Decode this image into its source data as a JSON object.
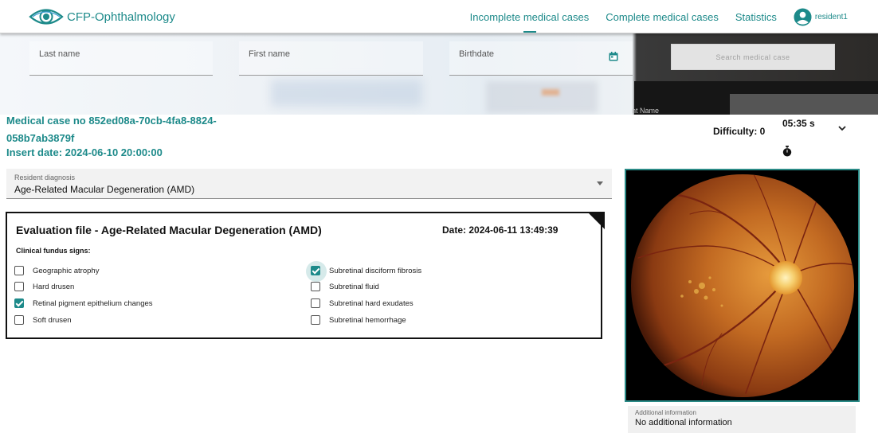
{
  "app": {
    "name": "CFP-Ophthalmology",
    "accent_color": "#1d8a8a"
  },
  "nav": {
    "items": [
      {
        "label": "Incomplete medical cases",
        "active": true
      },
      {
        "label": "Complete medical cases",
        "active": false
      },
      {
        "label": "Statistics",
        "active": false
      }
    ],
    "user": {
      "name": "resident1",
      "icon": "account-circle-icon"
    }
  },
  "search": {
    "last_name_placeholder": "Last name",
    "first_name_placeholder": "First name",
    "birthdate_placeholder": "Birthdate",
    "button_label": "Search medical case",
    "background_text": "nt Name"
  },
  "case": {
    "title": "Medical case no 852ed08a-70cb-4fa8-8824-058b7ab3879f",
    "insert_date": "Insert date: 2024-06-10 20:00:00",
    "difficulty": "Difficulty: 0",
    "timer": "05:35 s"
  },
  "diagnosis": {
    "label": "Resident diagnosis",
    "value": "Age-Related Macular Degeneration (AMD)"
  },
  "evaluation": {
    "title": "Evaluation file - Age-Related Macular Degeneration (AMD)",
    "date": "Date: 2024-06-11 13:49:39",
    "signs_label": "Clinical fundus signs:",
    "signs": [
      {
        "label": "Geographic atrophy",
        "checked": false
      },
      {
        "label": "Hard drusen",
        "checked": false
      },
      {
        "label": "Retinal pigment epithelium changes",
        "checked": true
      },
      {
        "label": "Soft drusen",
        "checked": false
      },
      {
        "label": "Subretinal disciform fibrosis",
        "checked": true
      },
      {
        "label": "Subretinal fluid",
        "checked": false
      },
      {
        "label": "Subretinal hard exudates",
        "checked": false
      },
      {
        "label": "Subretinal hemorrhage",
        "checked": false
      }
    ]
  },
  "additional": {
    "label": "Additional information",
    "value": "No additional information"
  }
}
